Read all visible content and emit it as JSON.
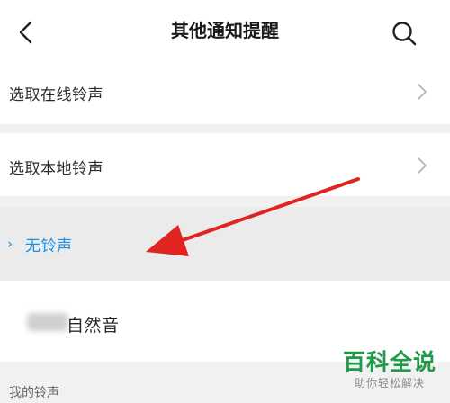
{
  "header": {
    "title": "其他通知提醒",
    "back_icon": "chevron-left-icon",
    "search_icon": "search-icon"
  },
  "list": {
    "online_label": "选取在线铃声",
    "local_label": "选取本地铃声",
    "none_label": "无铃声",
    "none_check": "›",
    "natural_label": "自然音"
  },
  "section": {
    "my_ringtones": "我的铃声"
  },
  "watermark": {
    "main": "百科全说",
    "sub": "助你轻松解决"
  },
  "colors": {
    "selected": "#1a8fe3",
    "arrow": "#e02420",
    "watermark": "#1f9a49"
  }
}
